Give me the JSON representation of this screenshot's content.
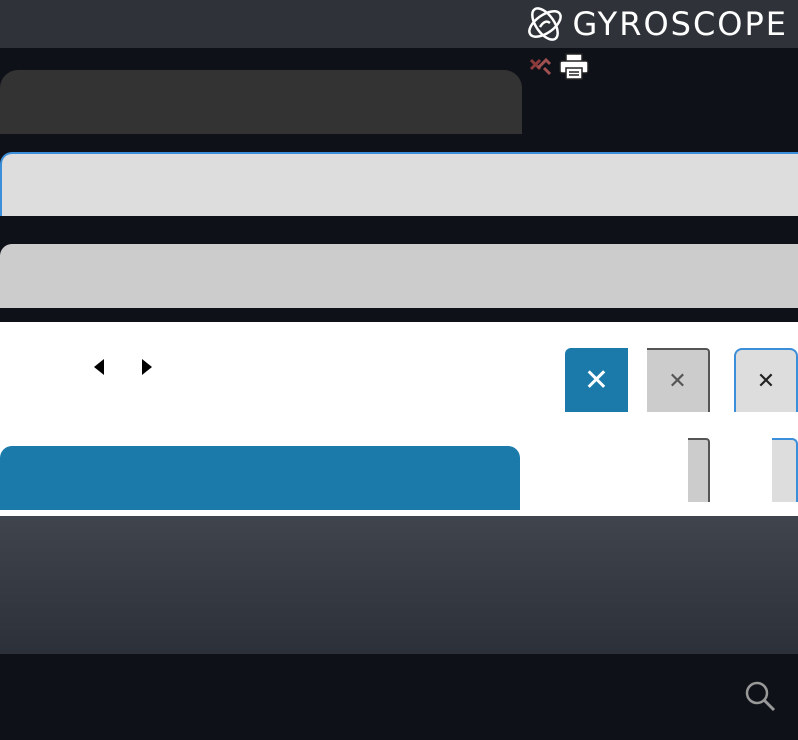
{
  "header": {
    "brand_name": "GYROSCOPE",
    "logo_icon": "gyroscope-logo-icon"
  },
  "toolbar": {
    "icons": [
      "close-red-icon",
      "print-icon"
    ]
  },
  "navigation": {
    "prev_icon": "caret-left-icon",
    "next_icon": "caret-right-icon"
  },
  "close_buttons": [
    {
      "glyph": "✕",
      "style": "primary"
    },
    {
      "glyph": "✕",
      "style": "gray"
    },
    {
      "glyph": "✕",
      "style": "light"
    }
  ],
  "footer": {
    "search_icon": "search-icon"
  },
  "colors": {
    "topbar": "#2f3339",
    "page_bg": "#0e1118",
    "dark_panel": "#333333",
    "light_bar": "#dddddd",
    "light_bar_alt": "#cccccc",
    "focus_border": "#3b8fd8",
    "primary_blue": "#1b7aa9",
    "white_panel": "#ffffff"
  }
}
